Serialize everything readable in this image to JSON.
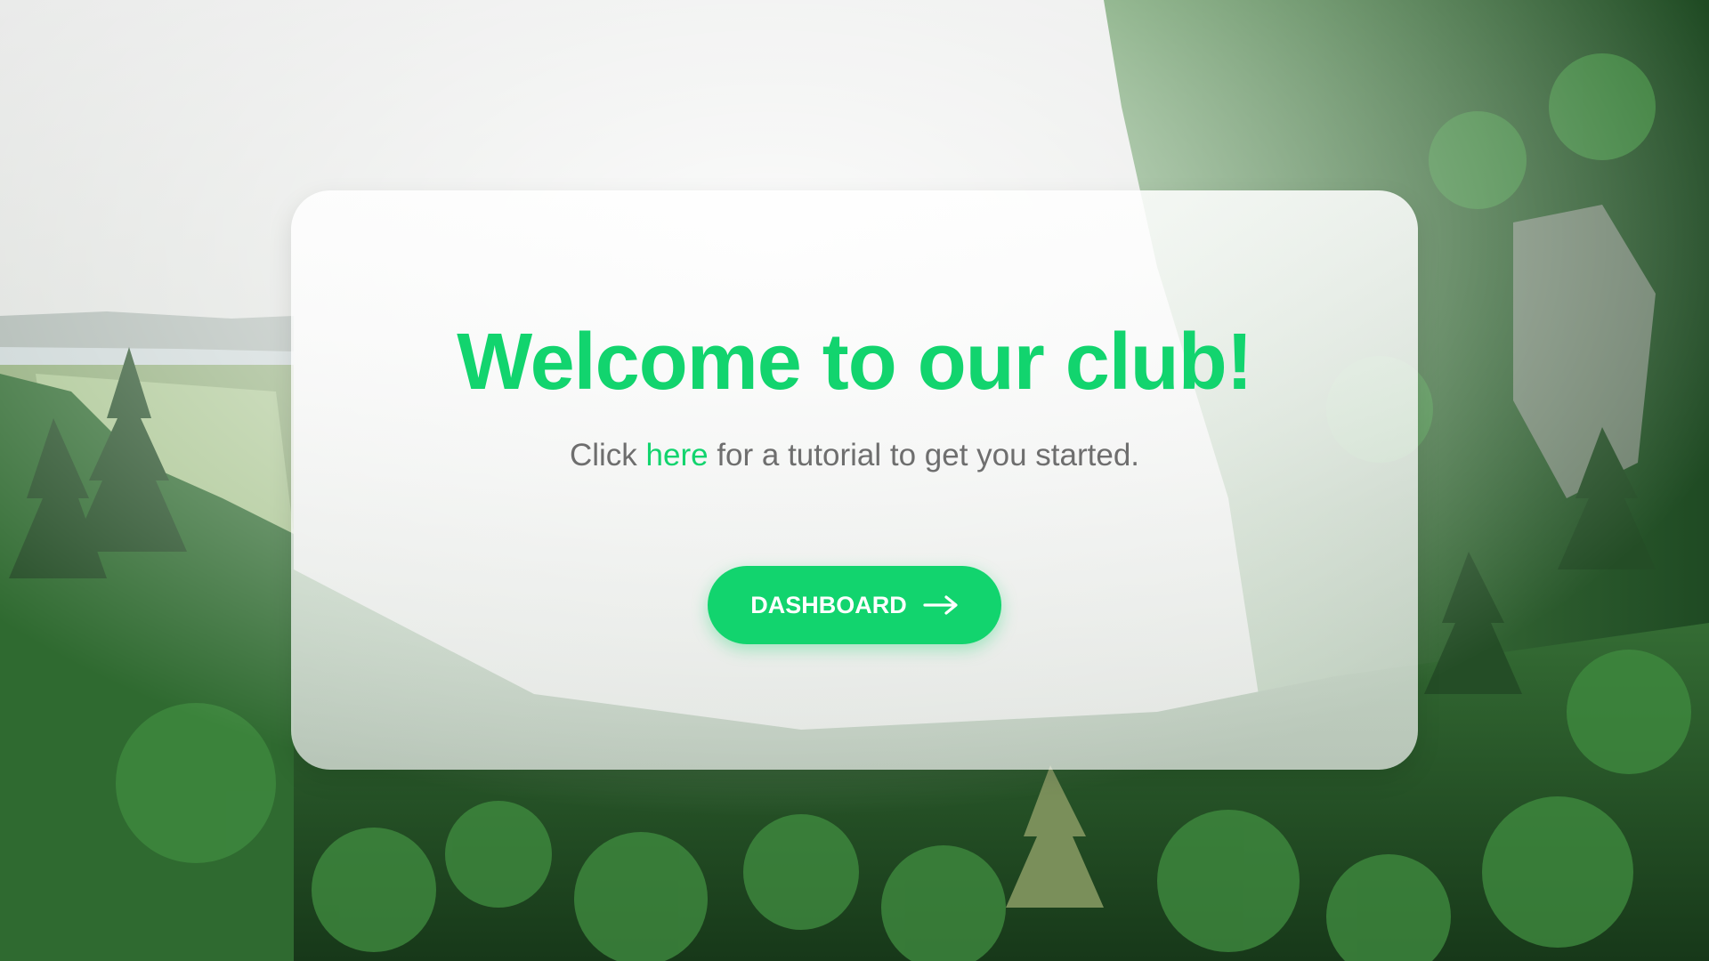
{
  "hero": {
    "title": "Welcome to our club!",
    "subtitle_prefix": "Click ",
    "subtitle_link": "here",
    "subtitle_suffix": " for a tutorial to get you started."
  },
  "cta": {
    "label": "DASHBOARD",
    "icon": "arrow-right-icon"
  },
  "background": {
    "scene": "misty-forest-mountain"
  },
  "colors": {
    "accent": "#12d46e",
    "text_muted": "#6e6e6e",
    "button_text": "#ffffff"
  }
}
